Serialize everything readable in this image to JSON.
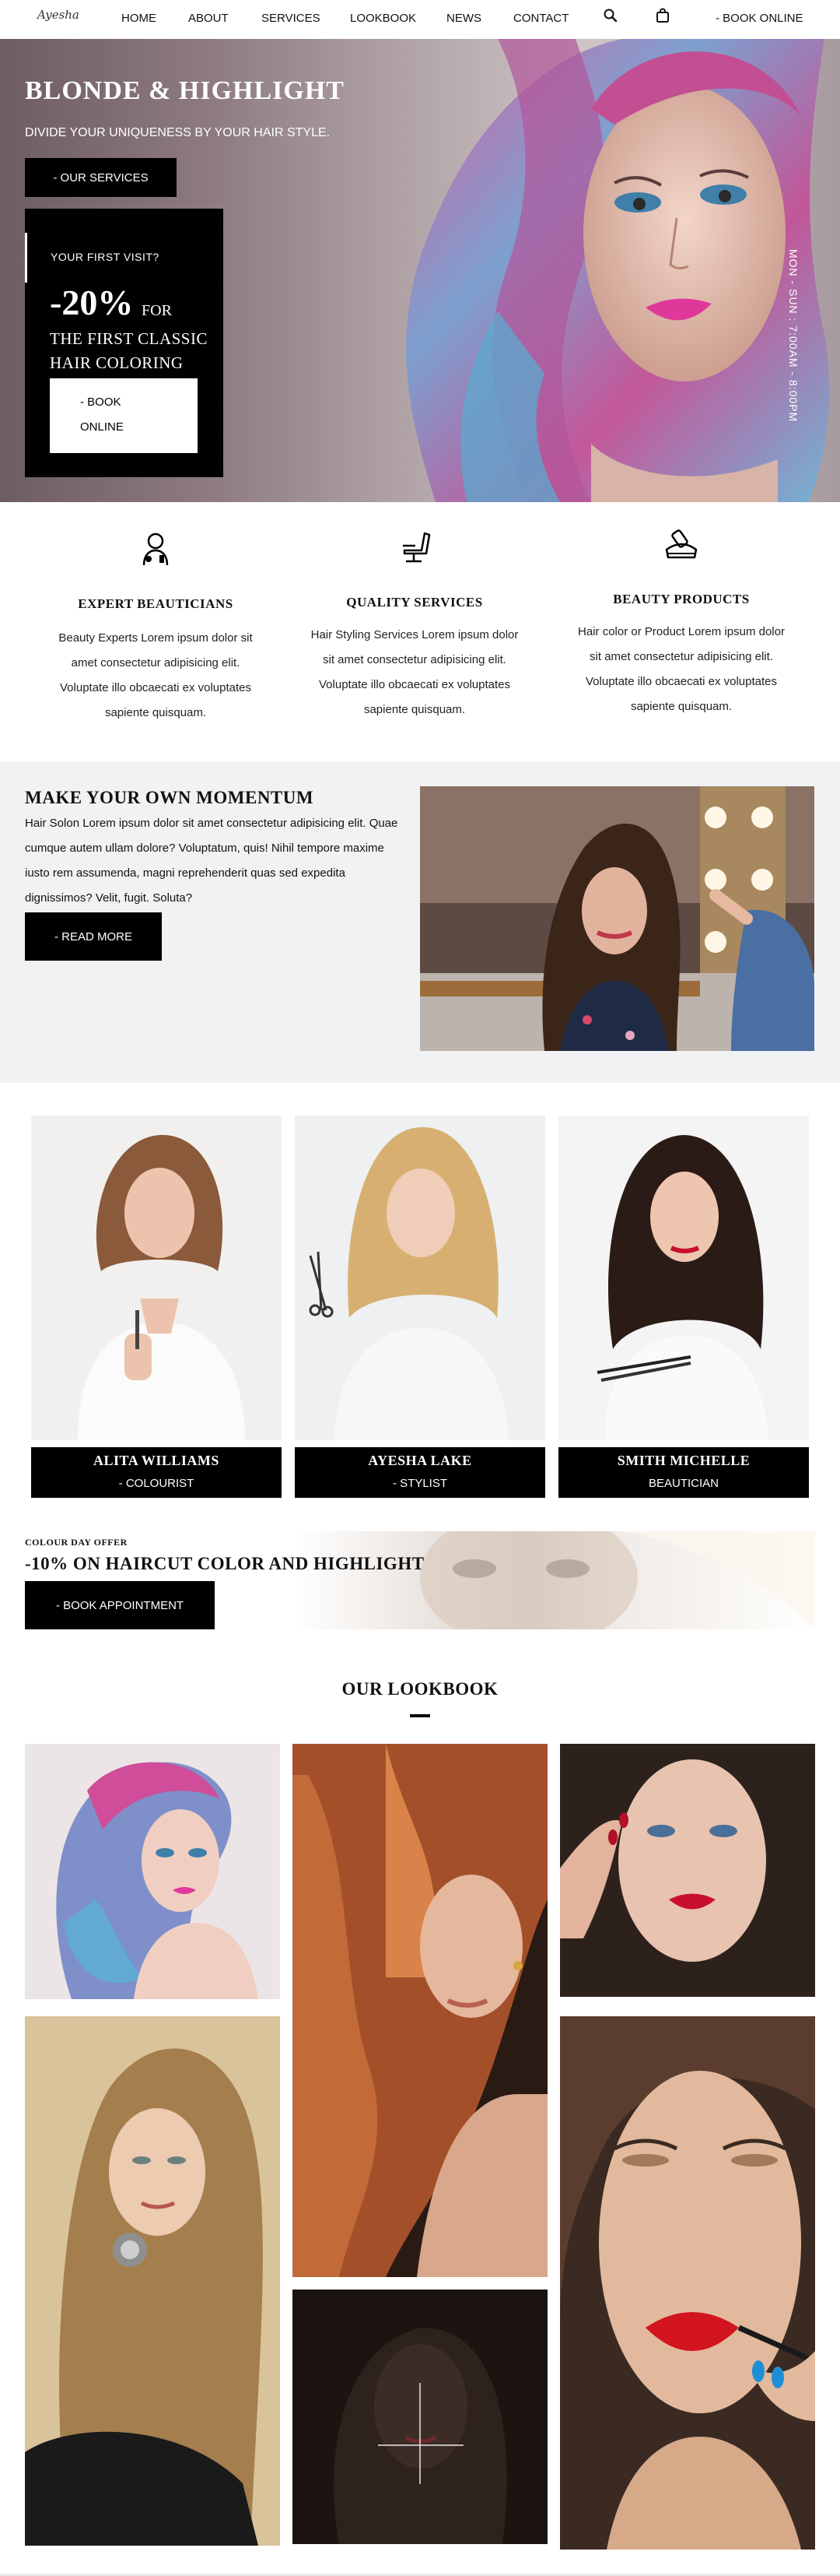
{
  "nav": {
    "logo": "Ayesha",
    "items": [
      "HOME",
      "ABOUT",
      "SERVICES",
      "LOOKBOOK",
      "NEWS",
      "CONTACT"
    ],
    "book_label": "- BOOK ONLINE",
    "search_icon": "search-icon",
    "bag_icon": "shopping-bag-icon"
  },
  "hero": {
    "title": "BLONDE & HIGHLIGHT",
    "subtitle": "DIVIDE YOUR UNIQUENESS BY YOUR HAIR STYLE.",
    "services_button": "- OUR SERVICES",
    "visit_label": "YOUR FIRST VISIT?",
    "visit_percent": "-20%",
    "visit_for": "FOR",
    "visit_line1": "THE FIRST CLASSIC",
    "visit_line2": "HAIR COLORING",
    "visit_book_line1": "- BOOK",
    "visit_book_line2": "ONLINE",
    "hours": "MON - SUN : 7:00AM - 8:00PM"
  },
  "features": [
    {
      "title": "EXPERT BEAUTICIANS",
      "text": "Beauty Experts Lorem ipsum dolor sit amet consectetur adipisicing elit. Voluptate illo obcaecati ex voluptates sapiente quisquam.",
      "icon": "beautician-icon"
    },
    {
      "title": "QUALITY SERVICES",
      "text": "Hair Styling Services Lorem ipsum dolor sit amet consectetur adipisicing elit. Voluptate illo obcaecati ex voluptates sapiente quisquam.",
      "icon": "salon-chair-icon"
    },
    {
      "title": "BEAUTY PRODUCTS",
      "text": "Hair color or Product Lorem ipsum dolor sit amet consectetur adipisicing elit. Voluptate illo obcaecati ex voluptates sapiente quisquam.",
      "icon": "beauty-products-icon"
    }
  ],
  "momentum": {
    "title": "MAKE YOUR OWN MOMENTUM",
    "text": "Hair Solon Lorem ipsum dolor sit amet consectetur adipisicing elit. Quae cumque autem ullam dolore? Voluptatum, quis! Nihil tempore maxime iusto rem assumenda, magni reprehenderit quas sed expedita dignissimos? Velit, fugit. Soluta?",
    "button": "- READ MORE"
  },
  "team": [
    {
      "name": "ALITA WILLIAMS",
      "role": "- COLOURIST"
    },
    {
      "name": "AYESHA LAKE",
      "role": "- STYLIST"
    },
    {
      "name": "SMITH MICHELLE",
      "role": "BEAUTICIAN"
    }
  ],
  "offer": {
    "label": "COLOUR DAY OFFER",
    "title": "-10% ON HAIRCUT COLOR AND HIGHLIGHT",
    "button": "- BOOK APPOINTMENT"
  },
  "lookbook": {
    "title": "OUR LOOKBOOK"
  }
}
